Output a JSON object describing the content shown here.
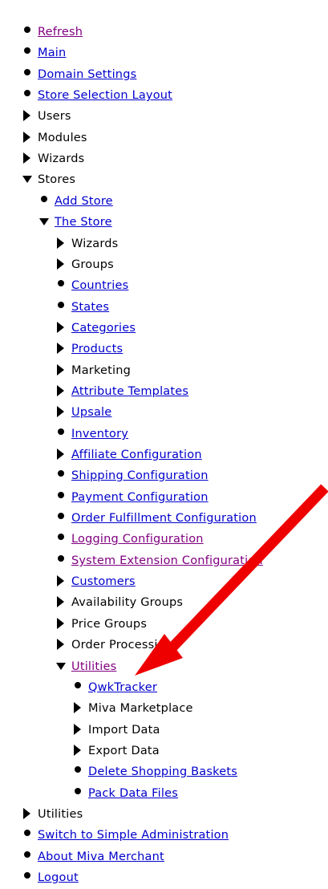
{
  "nav": {
    "items": [
      {
        "label": "Refresh",
        "marker": "bullet",
        "link": true,
        "visited": true,
        "indent": 0
      },
      {
        "label": "Main",
        "marker": "bullet",
        "link": true,
        "visited": false,
        "indent": 0
      },
      {
        "label": "Domain Settings",
        "marker": "bullet",
        "link": true,
        "visited": false,
        "indent": 0
      },
      {
        "label": "Store Selection Layout",
        "marker": "bullet",
        "link": true,
        "visited": false,
        "indent": 0
      },
      {
        "label": "Users",
        "marker": "collapsed",
        "link": false,
        "visited": false,
        "indent": 0
      },
      {
        "label": "Modules",
        "marker": "collapsed",
        "link": false,
        "visited": false,
        "indent": 0
      },
      {
        "label": "Wizards",
        "marker": "collapsed",
        "link": false,
        "visited": false,
        "indent": 0
      },
      {
        "label": "Stores",
        "marker": "expanded",
        "link": false,
        "visited": false,
        "indent": 0
      },
      {
        "label": "Add Store",
        "marker": "bullet",
        "link": true,
        "visited": false,
        "indent": 1
      },
      {
        "label": "The Store",
        "marker": "expanded",
        "link": true,
        "visited": false,
        "indent": 1
      },
      {
        "label": "Wizards",
        "marker": "collapsed",
        "link": false,
        "visited": false,
        "indent": 2
      },
      {
        "label": "Groups",
        "marker": "collapsed",
        "link": false,
        "visited": false,
        "indent": 2
      },
      {
        "label": "Countries",
        "marker": "bullet",
        "link": true,
        "visited": false,
        "indent": 2
      },
      {
        "label": "States",
        "marker": "bullet",
        "link": true,
        "visited": false,
        "indent": 2
      },
      {
        "label": "Categories",
        "marker": "collapsed",
        "link": true,
        "visited": false,
        "indent": 2
      },
      {
        "label": "Products",
        "marker": "collapsed",
        "link": true,
        "visited": false,
        "indent": 2
      },
      {
        "label": "Marketing",
        "marker": "collapsed",
        "link": false,
        "visited": false,
        "indent": 2
      },
      {
        "label": "Attribute Templates",
        "marker": "collapsed",
        "link": true,
        "visited": false,
        "indent": 2
      },
      {
        "label": "Upsale",
        "marker": "collapsed",
        "link": true,
        "visited": false,
        "indent": 2
      },
      {
        "label": "Inventory",
        "marker": "bullet",
        "link": true,
        "visited": false,
        "indent": 2
      },
      {
        "label": "Affiliate Configuration",
        "marker": "collapsed",
        "link": true,
        "visited": false,
        "indent": 2
      },
      {
        "label": "Shipping Configuration",
        "marker": "bullet",
        "link": true,
        "visited": false,
        "indent": 2
      },
      {
        "label": "Payment Configuration",
        "marker": "bullet",
        "link": true,
        "visited": false,
        "indent": 2
      },
      {
        "label": "Order Fulfillment Configuration",
        "marker": "bullet",
        "link": true,
        "visited": false,
        "indent": 2
      },
      {
        "label": "Logging Configuration",
        "marker": "bullet",
        "link": true,
        "visited": true,
        "indent": 2
      },
      {
        "label": "System Extension Configuration",
        "marker": "bullet",
        "link": true,
        "visited": true,
        "indent": 2
      },
      {
        "label": "Customers",
        "marker": "collapsed",
        "link": true,
        "visited": false,
        "indent": 2
      },
      {
        "label": "Availability Groups",
        "marker": "collapsed",
        "link": false,
        "visited": false,
        "indent": 2
      },
      {
        "label": "Price Groups",
        "marker": "collapsed",
        "link": false,
        "visited": false,
        "indent": 2
      },
      {
        "label": "Order Processing",
        "marker": "collapsed",
        "link": false,
        "visited": false,
        "indent": 2
      },
      {
        "label": "Utilities",
        "marker": "expanded",
        "link": true,
        "visited": true,
        "indent": 2
      },
      {
        "label": "QwkTracker",
        "marker": "bullet",
        "link": true,
        "visited": false,
        "indent": 3
      },
      {
        "label": "Miva Marketplace",
        "marker": "collapsed",
        "link": false,
        "visited": false,
        "indent": 3
      },
      {
        "label": "Import Data",
        "marker": "collapsed",
        "link": false,
        "visited": false,
        "indent": 3
      },
      {
        "label": "Export Data",
        "marker": "collapsed",
        "link": false,
        "visited": false,
        "indent": 3
      },
      {
        "label": "Delete Shopping Baskets",
        "marker": "bullet",
        "link": true,
        "visited": false,
        "indent": 3
      },
      {
        "label": "Pack Data Files",
        "marker": "bullet",
        "link": true,
        "visited": false,
        "indent": 3
      },
      {
        "label": "Utilities",
        "marker": "collapsed",
        "link": false,
        "visited": false,
        "indent": 0
      },
      {
        "label": "Switch to Simple Administration",
        "marker": "bullet",
        "link": true,
        "visited": false,
        "indent": 0
      },
      {
        "label": "About Miva Merchant",
        "marker": "bullet",
        "link": true,
        "visited": false,
        "indent": 0
      },
      {
        "label": "Logout",
        "marker": "bullet",
        "link": true,
        "visited": false,
        "indent": 0
      }
    ]
  },
  "colors": {
    "link": "#0000cc",
    "visited_link": "#800080",
    "text": "#000000",
    "annotation_arrow": "#ee0000"
  },
  "annotation": {
    "icon": "red-arrow-icon",
    "points_to": "QwkTracker"
  }
}
